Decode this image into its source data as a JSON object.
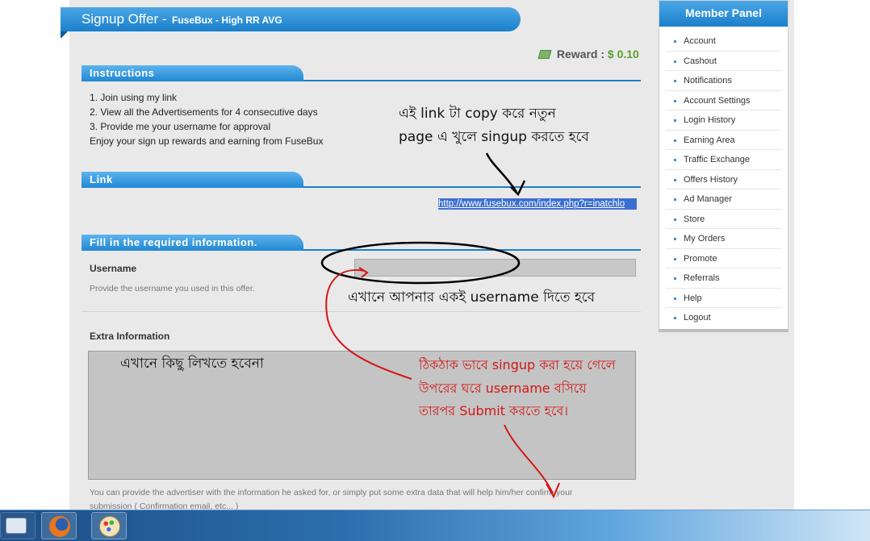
{
  "page": {
    "title_main": "Signup Offer -",
    "title_sub": "FuseBux - High RR AVG",
    "reward_label": "Reward :",
    "reward_value": "$ 0.10"
  },
  "instructions": {
    "heading": "Instructions",
    "lines": [
      "1. Join using my link",
      "2. View all the Advertisements for 4 consecutive days",
      "3. Provide me your username for approval",
      "Enjoy your sign up rewards and earning from FuseBux"
    ]
  },
  "link": {
    "heading": "Link",
    "url": "http://www.fusebux.com/index.php?r=inatchlo"
  },
  "form": {
    "heading": "Fill in the required information.",
    "username_label": "Username",
    "username_help": "Provide the username you used in this offer.",
    "username_value": "",
    "extra_label": "Extra Information",
    "extra_help": "You can provide the advertiser with the information he asked for, or simply put some extra data that will help him/her confirm your submission ( Confirmation email, etc... )",
    "extra_value": ""
  },
  "member_panel": {
    "heading": "Member Panel",
    "items": [
      "Account",
      "Cashout",
      "Notifications",
      "Account Settings",
      "Login History",
      "Earning Area",
      "Traffic Exchange",
      "Offers History",
      "Ad Manager",
      "Store",
      "My Orders",
      "Promote",
      "Referrals",
      "Help",
      "Logout"
    ]
  },
  "annotations": {
    "copy_link_line1": "এই link টা copy করে নতুন",
    "copy_link_line2": "page এ খুলে singup করতে হবে",
    "username_note": "এখানে আপনার একই  username দিতে হবে",
    "extra_note": "এখানে কিছু লিখতে হবেনা",
    "submit_line1": "ঠিকঠাক ভাবে singup করা হয়ে গেলে",
    "submit_line2": "উপরের ঘরে username বসিয়ে",
    "submit_line3": "তারপর Submit করতে হবে।"
  },
  "taskbar": {
    "icons": [
      "email-app-icon",
      "firefox-icon",
      "paint-icon"
    ]
  },
  "colors": {
    "accent": "#1b7fcb",
    "reward_green": "#5aa02c",
    "annotation_red": "#d41616"
  }
}
